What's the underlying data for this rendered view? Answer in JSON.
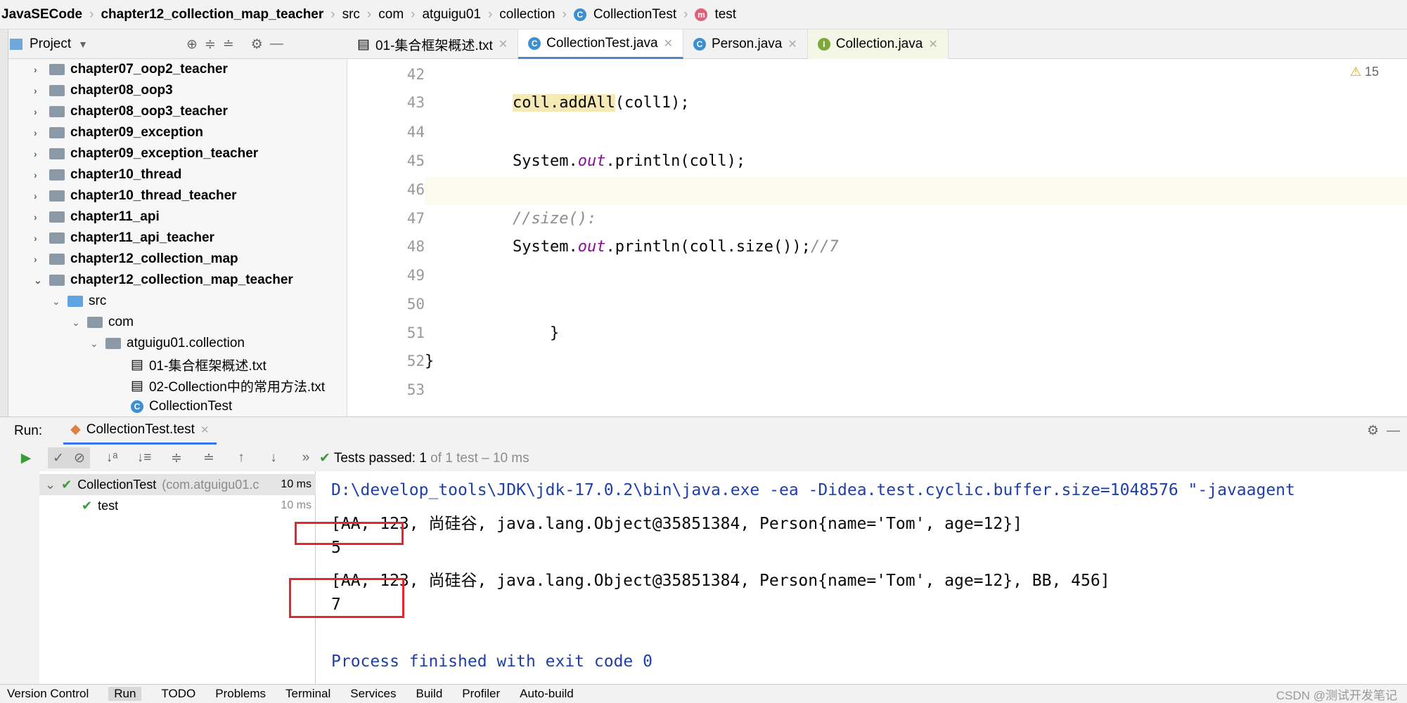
{
  "breadcrumb": [
    "JavaSECode",
    "chapter12_collection_map_teacher",
    "src",
    "com",
    "atguigu01",
    "collection",
    "CollectionTest",
    "test"
  ],
  "project_panel": {
    "title": "Project",
    "items": [
      {
        "label": "chapter07_oop2_teacher",
        "bold": true
      },
      {
        "label": "chapter08_oop3",
        "bold": true
      },
      {
        "label": "chapter08_oop3_teacher",
        "bold": true
      },
      {
        "label": "chapter09_exception",
        "bold": true
      },
      {
        "label": "chapter09_exception_teacher",
        "bold": true
      },
      {
        "label": "chapter10_thread",
        "bold": true
      },
      {
        "label": "chapter10_thread_teacher",
        "bold": true
      },
      {
        "label": "chapter11_api",
        "bold": true
      },
      {
        "label": "chapter11_api_teacher",
        "bold": true
      },
      {
        "label": "chapter12_collection_map",
        "bold": true
      },
      {
        "label": "chapter12_collection_map_teacher",
        "bold": true,
        "expanded": true
      },
      {
        "label": "src"
      },
      {
        "label": "com"
      },
      {
        "label": "atguigu01.collection"
      },
      {
        "label": "01-集合框架概述.txt"
      },
      {
        "label": "02-Collection中的常用方法.txt"
      },
      {
        "label": "CollectionTest"
      }
    ]
  },
  "tabs": [
    {
      "label": "01-集合框架概述.txt"
    },
    {
      "label": "CollectionTest.java",
      "active": true
    },
    {
      "label": "Person.java"
    },
    {
      "label": "Collection.java"
    }
  ],
  "editor": {
    "warnings": "15",
    "lines": [
      {
        "n": "42",
        "code": ""
      },
      {
        "n": "43",
        "code": "coll.addAll(coll1);"
      },
      {
        "n": "44",
        "code": ""
      },
      {
        "n": "45",
        "code": "System.out.println(coll);"
      },
      {
        "n": "46",
        "code": ""
      },
      {
        "n": "47",
        "code": "//size():"
      },
      {
        "n": "48",
        "code": "System.out.println(coll.size());//7"
      },
      {
        "n": "49",
        "code": ""
      },
      {
        "n": "50",
        "code": ""
      },
      {
        "n": "51",
        "code": "    }"
      },
      {
        "n": "52",
        "code": "}"
      },
      {
        "n": "53",
        "code": ""
      }
    ]
  },
  "run": {
    "label": "Run:",
    "tab": "CollectionTest.test",
    "status_prefix": "Tests passed:",
    "passed": "1",
    "status_suffix": "of 1 test – 10 ms",
    "tree": [
      {
        "label": "CollectionTest",
        "pkg": "(com.atguigu01.c",
        "time": "10 ms"
      },
      {
        "label": "test",
        "time": "10 ms"
      }
    ],
    "output": [
      "D:\\develop_tools\\JDK\\jdk-17.0.2\\bin\\java.exe -ea -Didea.test.cyclic.buffer.size=1048576 \"-javaagent",
      "[AA, 123, 尚硅谷, java.lang.Object@35851384, Person{name='Tom', age=12}]",
      "5",
      "[AA, 123, 尚硅谷, java.lang.Object@35851384, Person{name='Tom', age=12}, BB, 456]",
      "7",
      "",
      "Process finished with exit code 0"
    ]
  },
  "statusbar": [
    "Version Control",
    "Run",
    "TODO",
    "Problems",
    "Terminal",
    "Services",
    "Build",
    "Profiler",
    "Auto-build"
  ],
  "watermark": "CSDN @测试开发笔记"
}
